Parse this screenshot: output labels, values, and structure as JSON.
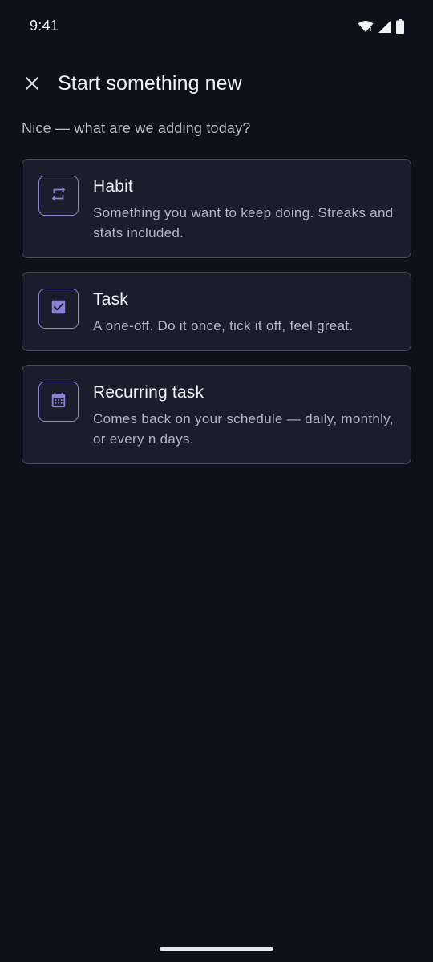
{
  "status_bar": {
    "time": "9:41",
    "icons": [
      "wifi-icon",
      "cellular-signal-icon",
      "battery-icon"
    ]
  },
  "header": {
    "close_icon": "close-icon",
    "title": "Start something new"
  },
  "subtitle": "Nice — what are we adding today?",
  "options": [
    {
      "icon": "repeat-icon",
      "title": "Habit",
      "description": "Something you want to keep doing. Streaks and stats included."
    },
    {
      "icon": "checkbox-icon",
      "title": "Task",
      "description": "A one-off. Do it once, tick it off, feel great."
    },
    {
      "icon": "calendar-icon",
      "title": "Recurring task",
      "description": "Comes back on your schedule — daily, monthly, or every n days."
    }
  ],
  "colors": {
    "background": "#0f111a",
    "card_background": "#1c1d2c",
    "card_border": "#4a4a5c",
    "accent": "#8c80d8",
    "text_primary": "#f3f2f8",
    "text_secondary": "#b5b4c2"
  }
}
